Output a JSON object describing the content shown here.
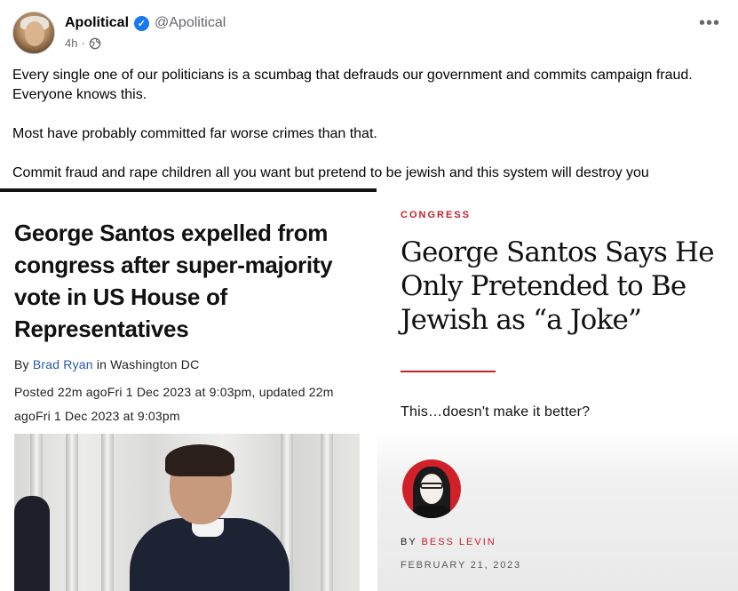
{
  "post": {
    "author_name": "Apolitical",
    "verified_mark": "✓",
    "handle": "@Apolitical",
    "time": "4h",
    "separator": "·",
    "more_label": "•••",
    "paragraphs": [
      "Every single one of our politicians is a scumbag that defrauds our government and commits campaign fraud. Everyone knows this.",
      "Most have probably committed far worse crimes than that.",
      "Commit fraud and rape children all you want but pretend to be jewish and this system will destroy you"
    ]
  },
  "left_article": {
    "headline": "George Santos expelled from congress after super-majority vote in US House of Representatives",
    "by_prefix": "By ",
    "author": "Brad Ryan",
    "by_suffix": " in Washington DC",
    "posted": "Posted 22m agoFri 1 Dec 2023 at 9:03pm, updated 22m agoFri 1 Dec 2023 at 9:03pm"
  },
  "right_article": {
    "kicker": "CONGRESS",
    "headline": "George Santos Says He Only Pretended to Be Jewish as “a Joke”",
    "dek": "This…doesn't make it better?",
    "by_prefix": "BY ",
    "author": "BESS LEVIN",
    "date": "FEBRUARY 21, 2023"
  },
  "colors": {
    "verified_blue": "#1877f2",
    "accent_red": "#c8202b",
    "link_blue": "#2b5aa8"
  },
  "icons": [
    "more-options-icon",
    "globe-icon",
    "verified-badge-icon"
  ]
}
